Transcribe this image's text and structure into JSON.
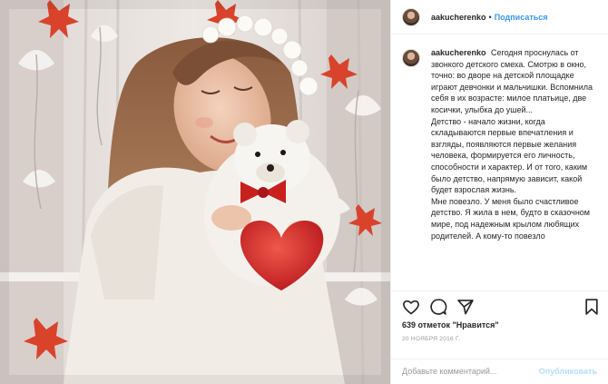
{
  "post": {
    "photo_alt": "girl-with-teddy-bear-photo"
  },
  "header": {
    "username": "aakucherenko",
    "separator": "•",
    "follow_label": "Подписаться"
  },
  "caption": {
    "author": "aakucherenko",
    "paragraphs": [
      "Сегодня проснулась от звонкого детского смеха. Смотрю в окно, точно: во дворе на детской площадке играют девчонки и мальчишки. Вспомнила себя в их возрасте: милое платьице, две косички, улыбка до ушей...",
      "Детство - начало жизни, когда складываются первые впечатления и взгляды, появляются первые желания человека, формируется его личность, способности и характер. И от того, каким было детство, напрямую зависит, какой будет взрослая жизнь.",
      "Мне повезло. У меня было счастливое детство. Я жила в нем, будто в сказочном мире, под надежным крылом любящих родителей. А кому-то повезло"
    ]
  },
  "actions": {
    "like_icon": "heart-icon",
    "comment_icon": "comment-icon",
    "share_icon": "share-icon",
    "save_icon": "bookmark-icon",
    "likes_text": "639 отметок \"Нравится\"",
    "date_text": "20 ноября 2016 г."
  },
  "comment_box": {
    "placeholder": "Добавьте комментарий...",
    "publish_label": "Опубликовать"
  },
  "colors": {
    "link_blue": "#3897f0",
    "publish_disabled": "#b2dffc",
    "border": "#efefef"
  }
}
